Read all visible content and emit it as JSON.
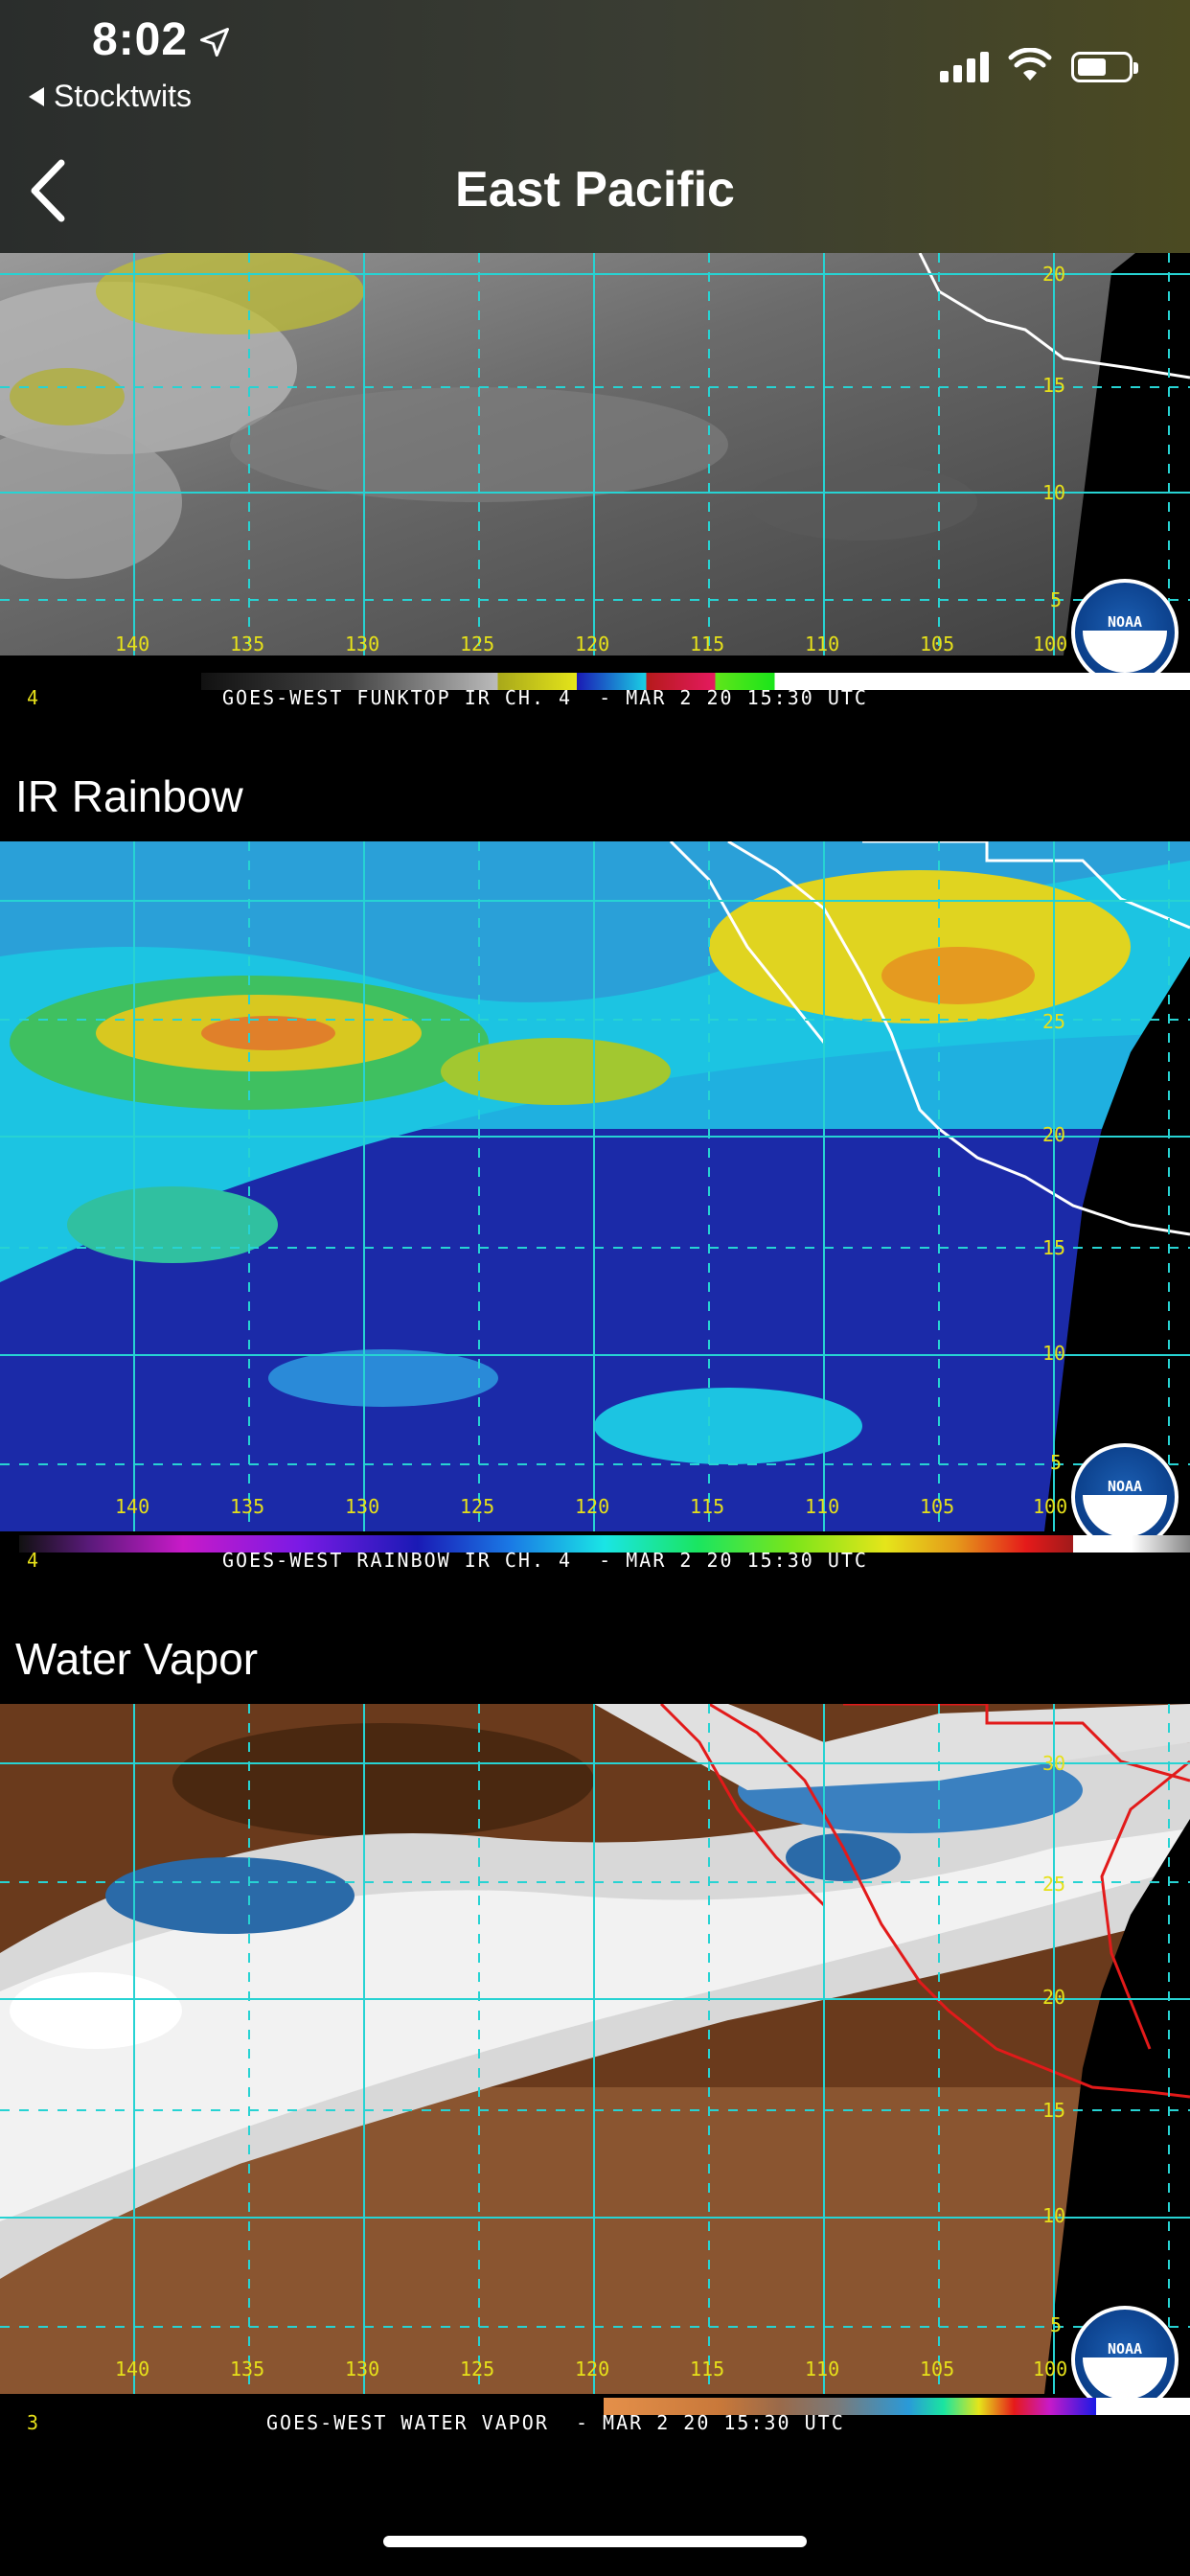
{
  "status_bar": {
    "time": "8:02",
    "back_app": "Stocktwits"
  },
  "nav": {
    "title": "East Pacific"
  },
  "images": [
    {
      "caption": "GOES-WEST FUNKTOP IR CH. 4  - MAR 2 20 15:30 UTC",
      "channel": "4",
      "lon_ticks": [
        "140",
        "135",
        "130",
        "125",
        "120",
        "115",
        "110",
        "105",
        "100"
      ],
      "lat_ticks": [
        "20",
        "15",
        "10",
        "5"
      ]
    },
    {
      "label": "IR Rainbow",
      "caption": "GOES-WEST RAINBOW IR CH. 4  - MAR 2 20 15:30 UTC",
      "channel": "4",
      "lon_ticks": [
        "140",
        "135",
        "130",
        "125",
        "120",
        "115",
        "110",
        "105",
        "100"
      ],
      "lat_ticks": [
        "25",
        "20",
        "15",
        "10",
        "5"
      ]
    },
    {
      "label": "Water Vapor",
      "caption": "GOES-WEST WATER VAPOR  - MAR 2 20 15:30 UTC",
      "channel": "3",
      "lon_ticks": [
        "140",
        "135",
        "130",
        "125",
        "120",
        "115",
        "110",
        "105",
        "100"
      ],
      "lat_ticks": [
        "30",
        "25",
        "20",
        "15",
        "10",
        "5"
      ]
    }
  ],
  "logo_text": "NOAA",
  "colors": {
    "grid": "#27d3d3",
    "tick": "#e6e01a",
    "coast_ir": "#ffffff",
    "coast_wv": "#e21a1a"
  }
}
